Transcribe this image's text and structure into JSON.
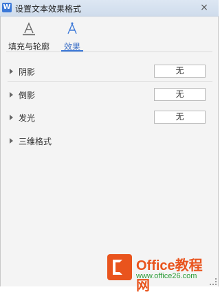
{
  "window": {
    "app_icon": "W",
    "title": "设置文本效果格式",
    "close_symbol": "×"
  },
  "tabs": [
    {
      "label": "填充与轮廓",
      "icon": "text-fill-outline-icon",
      "active": false
    },
    {
      "label": "效果",
      "icon": "text-effects-icon",
      "active": true
    }
  ],
  "effects": [
    {
      "label": "阴影",
      "value": "无"
    },
    {
      "label": "倒影",
      "value": "无"
    },
    {
      "label": "发光",
      "value": "无"
    },
    {
      "label": "三维格式"
    }
  ],
  "watermark": {
    "text": "Office教程网",
    "sub": "www.office26.com"
  },
  "colors": {
    "accent": "#3b78d8",
    "watermark_orange": "#e9541d"
  }
}
